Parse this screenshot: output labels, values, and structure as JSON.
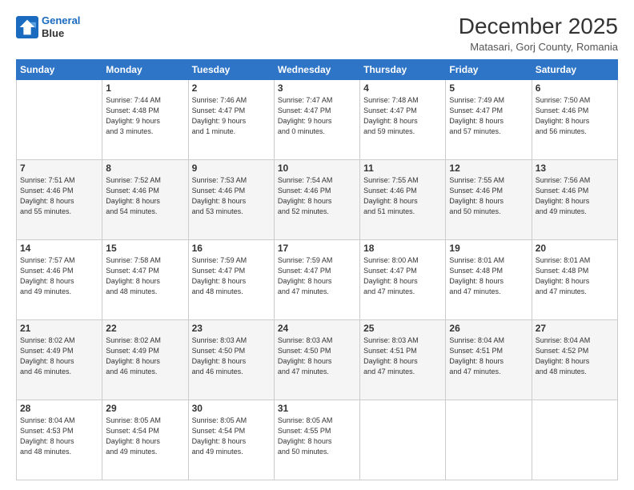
{
  "logo": {
    "line1": "General",
    "line2": "Blue"
  },
  "title": "December 2025",
  "subtitle": "Matasari, Gorj County, Romania",
  "days_header": [
    "Sunday",
    "Monday",
    "Tuesday",
    "Wednesday",
    "Thursday",
    "Friday",
    "Saturday"
  ],
  "weeks": [
    [
      {
        "day": "",
        "info": ""
      },
      {
        "day": "1",
        "info": "Sunrise: 7:44 AM\nSunset: 4:48 PM\nDaylight: 9 hours\nand 3 minutes."
      },
      {
        "day": "2",
        "info": "Sunrise: 7:46 AM\nSunset: 4:47 PM\nDaylight: 9 hours\nand 1 minute."
      },
      {
        "day": "3",
        "info": "Sunrise: 7:47 AM\nSunset: 4:47 PM\nDaylight: 9 hours\nand 0 minutes."
      },
      {
        "day": "4",
        "info": "Sunrise: 7:48 AM\nSunset: 4:47 PM\nDaylight: 8 hours\nand 59 minutes."
      },
      {
        "day": "5",
        "info": "Sunrise: 7:49 AM\nSunset: 4:47 PM\nDaylight: 8 hours\nand 57 minutes."
      },
      {
        "day": "6",
        "info": "Sunrise: 7:50 AM\nSunset: 4:46 PM\nDaylight: 8 hours\nand 56 minutes."
      }
    ],
    [
      {
        "day": "7",
        "info": "Sunrise: 7:51 AM\nSunset: 4:46 PM\nDaylight: 8 hours\nand 55 minutes."
      },
      {
        "day": "8",
        "info": "Sunrise: 7:52 AM\nSunset: 4:46 PM\nDaylight: 8 hours\nand 54 minutes."
      },
      {
        "day": "9",
        "info": "Sunrise: 7:53 AM\nSunset: 4:46 PM\nDaylight: 8 hours\nand 53 minutes."
      },
      {
        "day": "10",
        "info": "Sunrise: 7:54 AM\nSunset: 4:46 PM\nDaylight: 8 hours\nand 52 minutes."
      },
      {
        "day": "11",
        "info": "Sunrise: 7:55 AM\nSunset: 4:46 PM\nDaylight: 8 hours\nand 51 minutes."
      },
      {
        "day": "12",
        "info": "Sunrise: 7:55 AM\nSunset: 4:46 PM\nDaylight: 8 hours\nand 50 minutes."
      },
      {
        "day": "13",
        "info": "Sunrise: 7:56 AM\nSunset: 4:46 PM\nDaylight: 8 hours\nand 49 minutes."
      }
    ],
    [
      {
        "day": "14",
        "info": "Sunrise: 7:57 AM\nSunset: 4:46 PM\nDaylight: 8 hours\nand 49 minutes."
      },
      {
        "day": "15",
        "info": "Sunrise: 7:58 AM\nSunset: 4:47 PM\nDaylight: 8 hours\nand 48 minutes."
      },
      {
        "day": "16",
        "info": "Sunrise: 7:59 AM\nSunset: 4:47 PM\nDaylight: 8 hours\nand 48 minutes."
      },
      {
        "day": "17",
        "info": "Sunrise: 7:59 AM\nSunset: 4:47 PM\nDaylight: 8 hours\nand 47 minutes."
      },
      {
        "day": "18",
        "info": "Sunrise: 8:00 AM\nSunset: 4:47 PM\nDaylight: 8 hours\nand 47 minutes."
      },
      {
        "day": "19",
        "info": "Sunrise: 8:01 AM\nSunset: 4:48 PM\nDaylight: 8 hours\nand 47 minutes."
      },
      {
        "day": "20",
        "info": "Sunrise: 8:01 AM\nSunset: 4:48 PM\nDaylight: 8 hours\nand 47 minutes."
      }
    ],
    [
      {
        "day": "21",
        "info": "Sunrise: 8:02 AM\nSunset: 4:49 PM\nDaylight: 8 hours\nand 46 minutes."
      },
      {
        "day": "22",
        "info": "Sunrise: 8:02 AM\nSunset: 4:49 PM\nDaylight: 8 hours\nand 46 minutes."
      },
      {
        "day": "23",
        "info": "Sunrise: 8:03 AM\nSunset: 4:50 PM\nDaylight: 8 hours\nand 46 minutes."
      },
      {
        "day": "24",
        "info": "Sunrise: 8:03 AM\nSunset: 4:50 PM\nDaylight: 8 hours\nand 47 minutes."
      },
      {
        "day": "25",
        "info": "Sunrise: 8:03 AM\nSunset: 4:51 PM\nDaylight: 8 hours\nand 47 minutes."
      },
      {
        "day": "26",
        "info": "Sunrise: 8:04 AM\nSunset: 4:51 PM\nDaylight: 8 hours\nand 47 minutes."
      },
      {
        "day": "27",
        "info": "Sunrise: 8:04 AM\nSunset: 4:52 PM\nDaylight: 8 hours\nand 48 minutes."
      }
    ],
    [
      {
        "day": "28",
        "info": "Sunrise: 8:04 AM\nSunset: 4:53 PM\nDaylight: 8 hours\nand 48 minutes."
      },
      {
        "day": "29",
        "info": "Sunrise: 8:05 AM\nSunset: 4:54 PM\nDaylight: 8 hours\nand 49 minutes."
      },
      {
        "day": "30",
        "info": "Sunrise: 8:05 AM\nSunset: 4:54 PM\nDaylight: 8 hours\nand 49 minutes."
      },
      {
        "day": "31",
        "info": "Sunrise: 8:05 AM\nSunset: 4:55 PM\nDaylight: 8 hours\nand 50 minutes."
      },
      {
        "day": "",
        "info": ""
      },
      {
        "day": "",
        "info": ""
      },
      {
        "day": "",
        "info": ""
      }
    ]
  ]
}
